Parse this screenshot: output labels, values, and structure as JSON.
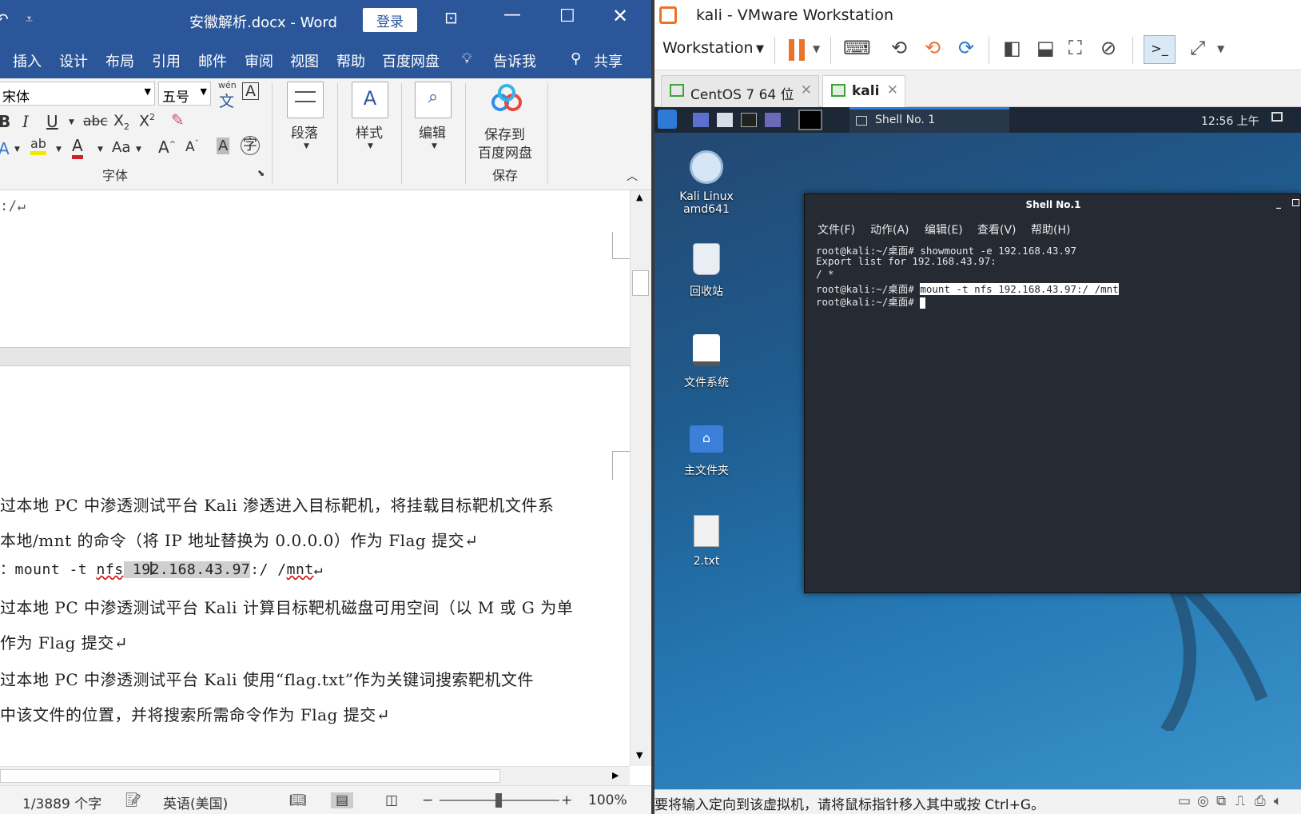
{
  "word": {
    "doc_title": "安徽解析.docx - Word",
    "login_label": "登录",
    "menu": [
      "插入",
      "设计",
      "布局",
      "引用",
      "邮件",
      "审阅",
      "视图",
      "帮助",
      "百度网盘",
      "告诉我"
    ],
    "share_label": "共享",
    "ribbon": {
      "font_name": "宋体",
      "font_size": "五号",
      "font_group_label": "字体",
      "paragraph_label": "段落",
      "styles_label": "样式",
      "edit_label": "编辑",
      "save_label_1": "保存到",
      "save_label_2": "百度网盘",
      "save_group_label": "保存",
      "wen_label": "wén",
      "wen_char": "文"
    },
    "doc": {
      "line0": ":/↵",
      "line1": "过本地 PC 中渗透测试平台 Kali 渗透进入目标靶机，将挂载目标靶机文件系",
      "line2": "本地/mnt 的命令（将 IP 地址替换为 0.0.0.0）作为 Flag 提交↵",
      "line3_prefix": "：mount -t ",
      "line3_nfs": "nfs",
      "line3_ip": " 192.168.43.97",
      "line3_suffix": ":/ /",
      "line3_mnt": "mnt",
      "line3_end": "↵",
      "line4": "过本地 PC 中渗透测试平台 Kali 计算目标靶机磁盘可用空间（以 M 或 G 为单",
      "line5": "作为 Flag 提交↵",
      "line6": "过本地 PC 中渗透测试平台 Kali 使用“flag.txt”作为关键词搜索靶机文件",
      "line7": "中该文件的位置，并将搜索所需命令作为 Flag 提交↵"
    },
    "status": {
      "pages": "1/3889 个字",
      "lang": "英语(美国)",
      "zoom": "100%"
    }
  },
  "vm": {
    "title": "kali - VMware Workstation",
    "workstation_menu": "Workstation",
    "tabs": [
      {
        "label": "CentOS 7 64 位"
      },
      {
        "label": "kali"
      }
    ],
    "panel": {
      "shell_task": "Shell No. 1",
      "clock": "12:56 上午"
    },
    "desktop_icons": [
      {
        "label": "Kali Linux",
        "label2": "amd641"
      },
      {
        "label": "回收站"
      },
      {
        "label": "文件系统"
      },
      {
        "label": "主文件夹"
      },
      {
        "label": "2.txt"
      }
    ],
    "terminal": {
      "title": "Shell No.1",
      "menu": [
        "文件(F)",
        "动作(A)",
        "编辑(E)",
        "查看(V)",
        "帮助(H)"
      ],
      "lines": [
        "root@kali:~/桌面# showmount -e 192.168.43.97",
        "Export list for 192.168.43.97:",
        "/ *",
        "root@kali:~/桌面# ",
        "root@kali:~/桌面# "
      ],
      "selected_cmd": "mount -t nfs 192.168.43.97:/ /mnt "
    },
    "status_text": "要将输入定向到该虚拟机，请将鼠标指针移入其中或按 Ctrl+G。"
  },
  "colors": {
    "word_blue": "#2b579a",
    "terminal_bg": "#252a33",
    "vm_pause": "#e8742c"
  }
}
